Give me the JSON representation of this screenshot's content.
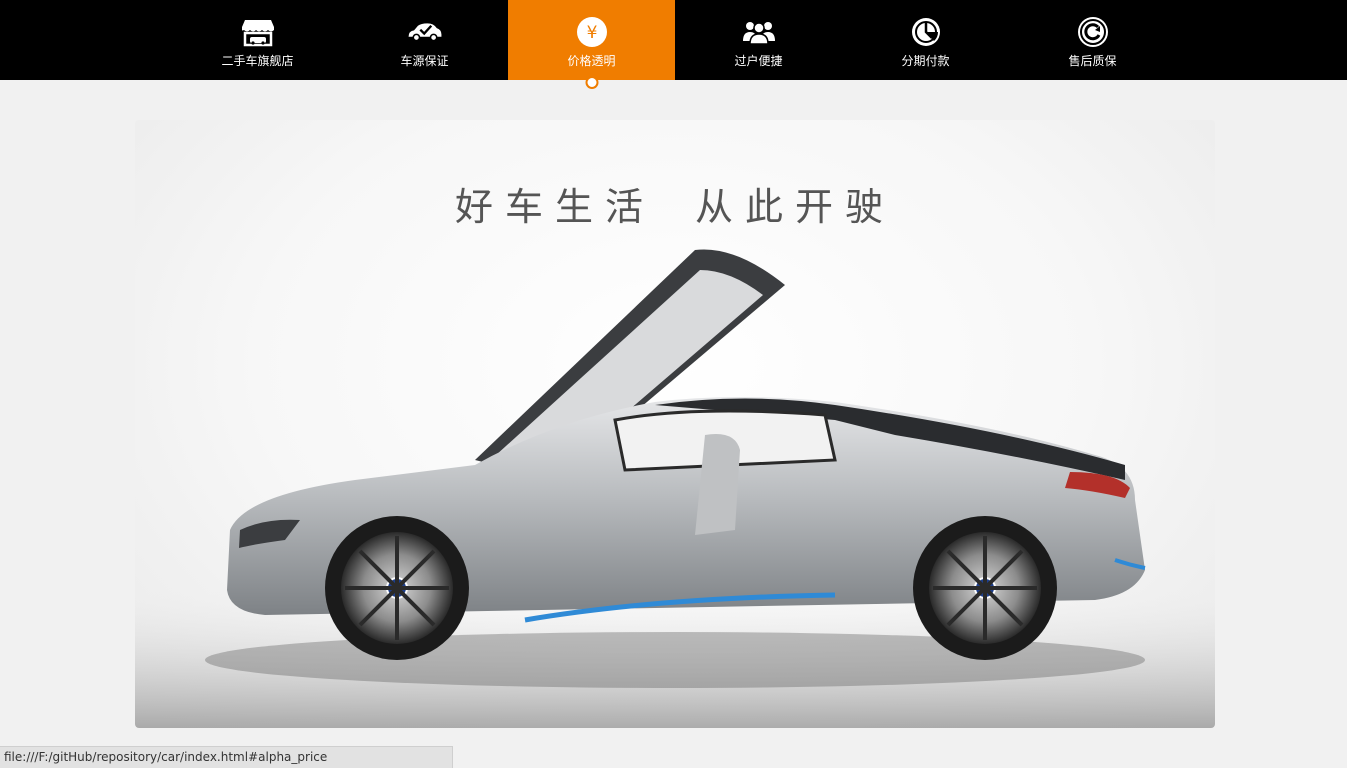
{
  "nav": {
    "items": [
      {
        "label": "二手车旗舰店",
        "icon": "storefront-icon",
        "active": false
      },
      {
        "label": "车源保证",
        "icon": "car-check-icon",
        "active": false
      },
      {
        "label": "价格透明",
        "icon": "yen-icon",
        "active": true,
        "glyph": "¥"
      },
      {
        "label": "过户便捷",
        "icon": "people-icon",
        "active": false
      },
      {
        "label": "分期付款",
        "icon": "clock-pie-icon",
        "active": false
      },
      {
        "label": "售后质保",
        "icon": "refresh-circle-icon",
        "active": false
      }
    ]
  },
  "banner": {
    "slogan_left": "好车生活",
    "slogan_right": "从此开驶"
  },
  "status": {
    "url": "file:///F:/gitHub/repository/car/index.html#alpha_price"
  },
  "colors": {
    "topbar": "#000000",
    "accent": "#f07d00",
    "page_bg": "#f1f1f1"
  }
}
